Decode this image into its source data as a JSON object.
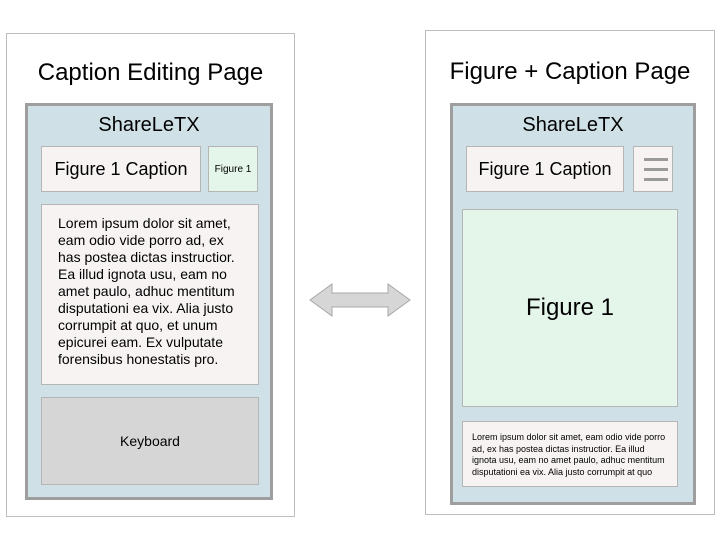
{
  "left_page": {
    "title": "Caption Editing Page",
    "app_name": "ShareLeTX",
    "caption_field": "Figure 1 Caption",
    "figure_thumb": "Figure 1",
    "body_text": "Lorem ipsum dolor sit amet, eam odio vide porro ad, ex has postea dictas instructior. Ea illud ignota usu, eam no amet paulo, adhuc mentitum disputationi ea vix. Alia justo corrumpit at quo, et unum epicurei eam. Ex vulputate forensibus honestatis pro.",
    "keyboard": "Keyboard"
  },
  "right_page": {
    "title": "Figure + Caption Page",
    "app_name": "ShareLeTX",
    "caption_field": "Figure 1 Caption",
    "menu_icon": "hamburger-menu-icon",
    "figure": "Figure 1",
    "body_text": "Lorem ipsum dolor sit amet, eam odio vide porro ad, ex has postea dictas instructior. Ea illud ignota usu, eam no amet paulo, adhuc mentitum disputationi ea vix. Alia justo corrumpit at quo"
  },
  "connector": {
    "type": "double-headed-arrow",
    "color": "#d6d6d6"
  }
}
